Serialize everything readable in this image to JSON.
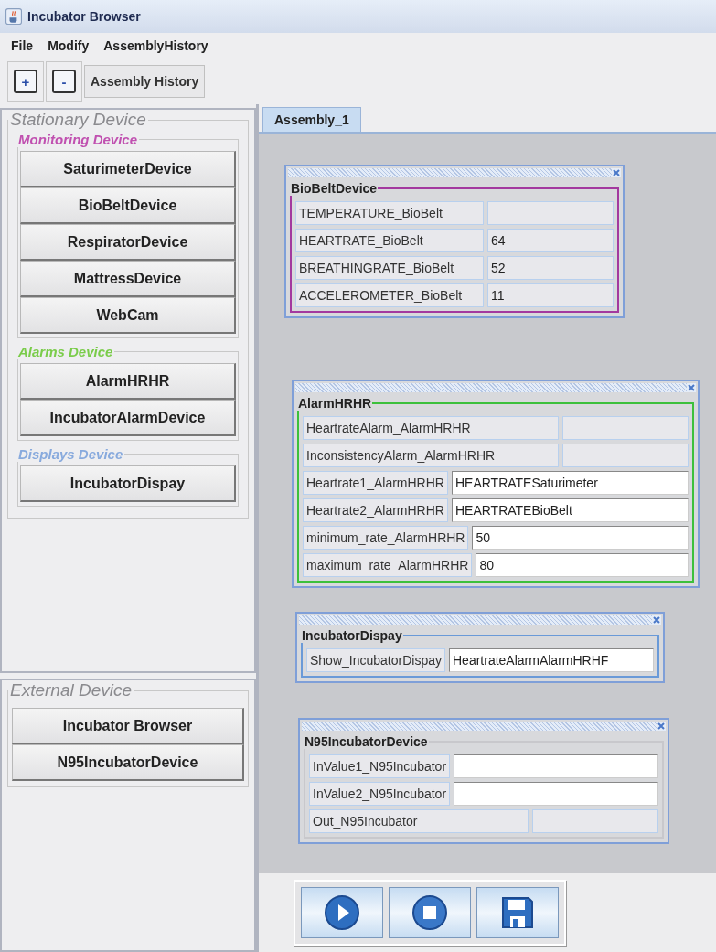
{
  "window": {
    "title": "Incubator Browser"
  },
  "menu": [
    {
      "label": "File"
    },
    {
      "label": "Modify"
    },
    {
      "label": "AssemblyHistory"
    }
  ],
  "toolbar": [
    {
      "kind": "icon",
      "label": "+"
    },
    {
      "kind": "icon",
      "label": "-"
    },
    {
      "kind": "text",
      "label": "Assembly History"
    }
  ],
  "sidebar": [
    {
      "title": "Stationary Device",
      "groups": [
        {
          "title": "Monitoring Device",
          "color": "#c050b0",
          "buttons": [
            "SaturimeterDevice",
            "BioBeltDevice",
            "RespiratorDevice",
            "MattressDevice",
            "WebCam"
          ]
        },
        {
          "title": "Alarms Device",
          "color": "#7acc4a",
          "buttons": [
            "AlarmHRHR",
            "IncubatorAlarmDevice"
          ]
        },
        {
          "title": "Displays Device",
          "color": "#88aadd",
          "buttons": [
            "IncubatorDispay"
          ]
        }
      ]
    },
    {
      "title": "External Device",
      "buttons": [
        "Incubator Browser",
        "N95IncubatorDevice"
      ]
    }
  ],
  "tabs": [
    {
      "label": "Assembly_1",
      "selected": true
    }
  ],
  "devices": [
    {
      "title": "BioBeltDevice",
      "color": "#a3399f",
      "rows": [
        {
          "label": "TEMPERATURE_BioBelt",
          "editable": false
        },
        {
          "label": "HEARTRATE_BioBelt",
          "value": "64",
          "editable": false
        },
        {
          "label": "BREATHINGRATE_BioBelt",
          "value": "52",
          "editable": false
        },
        {
          "label": "ACCELEROMETER_BioBelt",
          "value": "11",
          "editable": false
        }
      ]
    },
    {
      "title": "AlarmHRHR",
      "color": "#3cc03c",
      "rows": [
        {
          "label": "HeartrateAlarm_AlarmHRHR",
          "editable": false
        },
        {
          "label": "InconsistencyAlarm_AlarmHRHR",
          "editable": false
        },
        {
          "label": "Heartrate1_AlarmHRHR",
          "value": "HEARTRATESaturimeter",
          "editable": true
        },
        {
          "label": "Heartrate2_AlarmHRHR",
          "value": "HEARTRATEBioBelt",
          "editable": true
        },
        {
          "label": "minimum_rate_AlarmHRHR",
          "value": "50",
          "editable": true
        },
        {
          "label": "maximum_rate_AlarmHRHR",
          "value": "80",
          "editable": true
        }
      ]
    },
    {
      "title": "IncubatorDispay",
      "color": "#6a9ad8",
      "rows": [
        {
          "label": "Show_IncubatorDispay",
          "value": "HeartrateAlarmAlarmHRHF",
          "editable": true
        }
      ]
    },
    {
      "title": "N95IncubatorDevice",
      "color": "#c8c8cc",
      "rows": [
        {
          "label": "InValue1_N95Incubator",
          "editable": true
        },
        {
          "label": "InValue2_N95Incubator",
          "editable": true
        },
        {
          "label": "Out_N95Incubator",
          "editable": false
        }
      ]
    }
  ],
  "controls": [
    {
      "kind": "play"
    },
    {
      "kind": "stop"
    },
    {
      "kind": "save"
    }
  ]
}
